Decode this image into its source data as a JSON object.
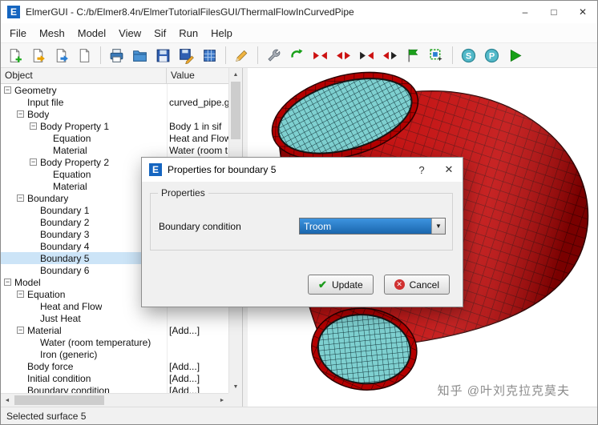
{
  "colors": {
    "accent": "#1f6fc4",
    "selection": "#cce4f7",
    "pipe_red": "#b40000",
    "pipe_red_dark": "#2a0000",
    "pipe_teal": "#7ed0d0",
    "pipe_teal_dark": "#10343a"
  },
  "window": {
    "title": "ElmerGUI - C:/b/Elmer8.4n/ElmerTutorialFilesGUI/ThermalFlowInCurvedPipe",
    "app_icon": "E",
    "minimize": "–",
    "maximize": "□",
    "close": "✕"
  },
  "menu": {
    "items": [
      "File",
      "Mesh",
      "Model",
      "View",
      "Sif",
      "Run",
      "Help"
    ]
  },
  "toolbar": {
    "items": [
      {
        "name": "new-project",
        "icon": "page-plus"
      },
      {
        "name": "open-project",
        "icon": "page-open"
      },
      {
        "name": "load-mesh",
        "icon": "page-out"
      },
      {
        "name": "new-file",
        "icon": "page"
      },
      {
        "name": "print",
        "icon": "printer",
        "sep_before": true
      },
      {
        "name": "open-folder",
        "icon": "folder"
      },
      {
        "name": "save-project",
        "icon": "floppy"
      },
      {
        "name": "save-as",
        "icon": "floppy-pen"
      },
      {
        "name": "model-summary",
        "icon": "grid-blue"
      },
      {
        "name": "edit-sif",
        "icon": "pencil",
        "sep_before": true
      },
      {
        "name": "mesh-tools",
        "icon": "wrench",
        "sep_before": true
      },
      {
        "name": "remesh",
        "icon": "arrow-green"
      },
      {
        "name": "divide-surface",
        "icon": "arrows-red-in"
      },
      {
        "name": "unify-surface",
        "icon": "arrows-red-out"
      },
      {
        "name": "divide-edge",
        "icon": "arrows-black-red"
      },
      {
        "name": "unify-edge",
        "icon": "arrows-red-black"
      },
      {
        "name": "surface-mesh-toggle",
        "icon": "flag-green"
      },
      {
        "name": "selection-box",
        "icon": "select-box"
      },
      {
        "name": "generate-sif",
        "icon": "circle-s",
        "sep_before": true
      },
      {
        "name": "postprocessor",
        "icon": "circle-p"
      },
      {
        "name": "run-solver",
        "icon": "play-green"
      }
    ]
  },
  "tree": {
    "columns": [
      "Object",
      "Value"
    ],
    "expander_glyph": "−",
    "rows": [
      {
        "label": "Geometry",
        "level": 0,
        "expand": true
      },
      {
        "label": "Input file",
        "level": 1,
        "value": "curved_pipe.g"
      },
      {
        "label": "Body",
        "level": 1,
        "expand": true
      },
      {
        "label": "Body Property 1",
        "level": 2,
        "expand": true,
        "value": "Body 1 in sif"
      },
      {
        "label": "Equation",
        "level": 3,
        "value": "Heat and Flow"
      },
      {
        "label": "Material",
        "level": 3,
        "value": "Water (room t"
      },
      {
        "label": "Body Property 2",
        "level": 2,
        "expand": true
      },
      {
        "label": "Equation",
        "level": 3
      },
      {
        "label": "Material",
        "level": 3
      },
      {
        "label": "Boundary",
        "level": 1,
        "expand": true
      },
      {
        "label": "Boundary 1",
        "level": 2
      },
      {
        "label": "Boundary 2",
        "level": 2
      },
      {
        "label": "Boundary 3",
        "level": 2
      },
      {
        "label": "Boundary 4",
        "level": 2
      },
      {
        "label": "Boundary 5",
        "level": 2,
        "selected": true
      },
      {
        "label": "Boundary 6",
        "level": 2
      },
      {
        "label": "Model",
        "level": 0,
        "expand": true
      },
      {
        "label": "Equation",
        "level": 1,
        "expand": true
      },
      {
        "label": "Heat and Flow",
        "level": 2
      },
      {
        "label": "Just Heat",
        "level": 2
      },
      {
        "label": "Material",
        "level": 1,
        "expand": true,
        "value": "[Add...]"
      },
      {
        "label": "Water (room temperature)",
        "level": 2
      },
      {
        "label": "Iron (generic)",
        "level": 2
      },
      {
        "label": "Body force",
        "level": 1,
        "value": "[Add...]"
      },
      {
        "label": "Initial condition",
        "level": 1,
        "value": "[Add...]"
      },
      {
        "label": "Boundary condition",
        "level": 1,
        "value": "[Add...]"
      }
    ]
  },
  "scrollbar": {
    "up": "▲",
    "down": "▼",
    "left": "◄",
    "right": "►"
  },
  "dialog": {
    "icon": "E",
    "title": "Properties for boundary 5",
    "help": "?",
    "close": "✕",
    "group_label": "Properties",
    "field_label": "Boundary condition",
    "combo_value": "Troom",
    "combo_arrow": "▼",
    "update_label": "Update",
    "cancel_label": "Cancel",
    "update_icon": "✔",
    "cancel_icon": "✕"
  },
  "statusbar": {
    "text": "Selected surface 5"
  },
  "watermark": {
    "text": "知乎 @叶刘克拉克莫夫"
  }
}
